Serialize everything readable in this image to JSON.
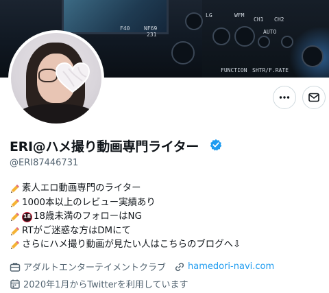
{
  "banner": {
    "labels": [
      "F40",
      "NF69",
      "231",
      "CH1",
      "CH2",
      "WFM",
      "LG",
      "AUTO",
      "FUNCTION",
      "SHTR/F.RATE"
    ]
  },
  "profile": {
    "display_name": "ERI@ハメ撮り動画専門ライター",
    "handle": "@ERI87446731",
    "verified": true
  },
  "actions": {
    "more_icon": "more-dots-icon",
    "message_icon": "mail-icon"
  },
  "bio": {
    "line1": "素人エロ動画専門のライター",
    "line2": "1000本以上のレビュー実績あり",
    "line3_badge": "18",
    "line3": "18歳未満のフォローはNG",
    "line4": "RTがご迷惑な方はDMにて",
    "line5": "さらにハメ撮り動画が見たい人はこちらのブログへ⇩"
  },
  "meta": {
    "category": "アダルトエンターテイメントクラブ",
    "website": "hamedori-navi.com",
    "joined": "2020年1月からTwitterを利用しています"
  },
  "colors": {
    "link": "#1d9bf0",
    "verified": "#1d9bf0",
    "secondary_text": "#536471"
  }
}
